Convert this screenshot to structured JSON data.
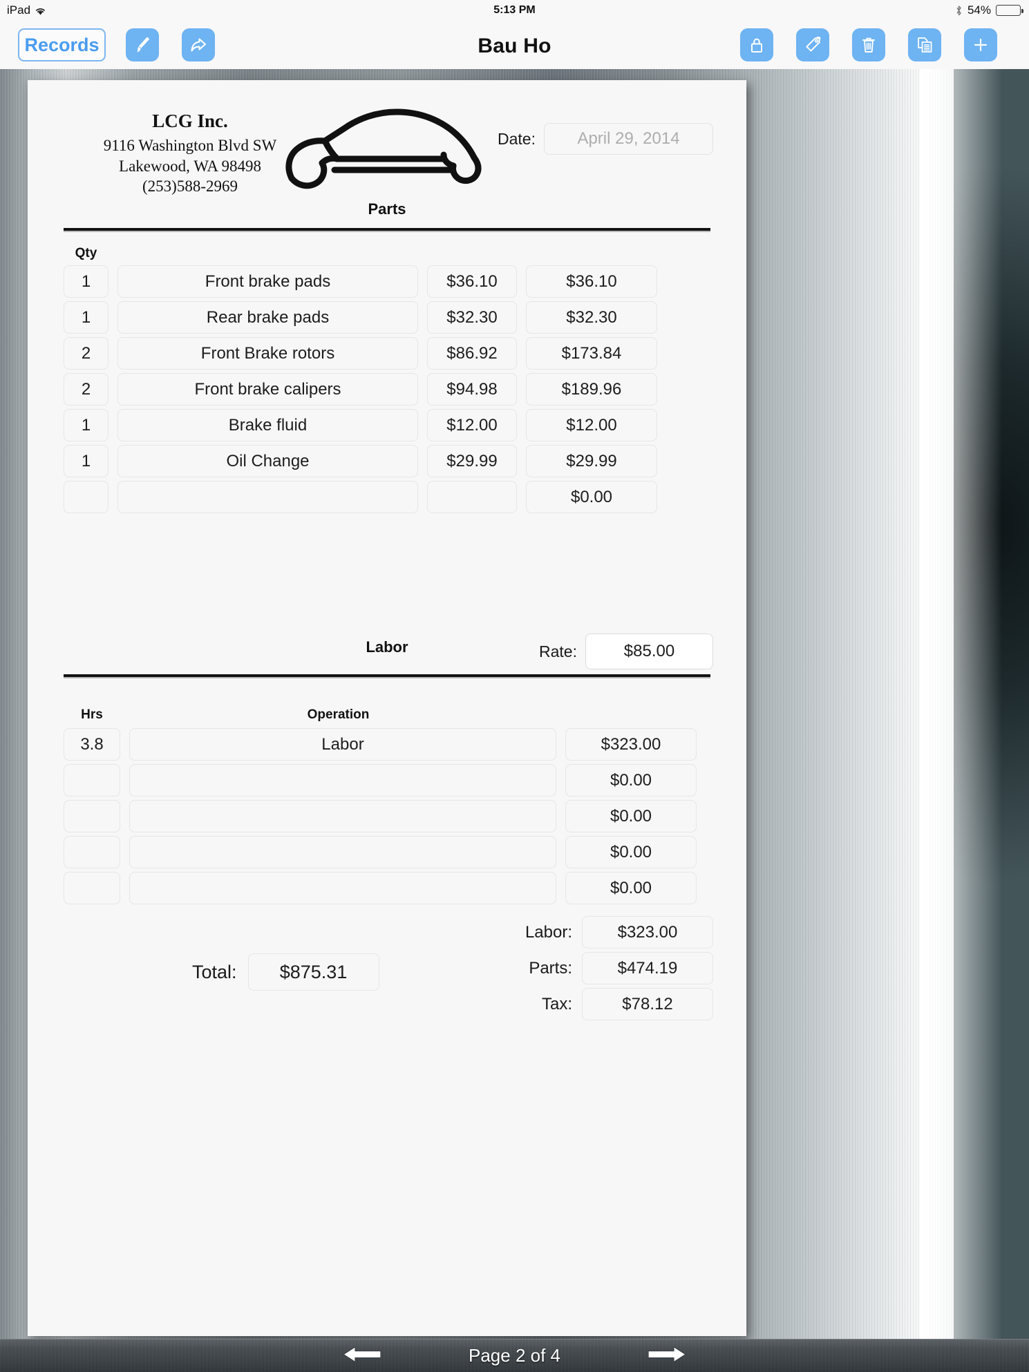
{
  "status_bar": {
    "device": "iPad",
    "wifi_icon": "wifi-icon",
    "time": "5:13 PM",
    "bluetooth_icon": "bluetooth-icon",
    "battery_percent": "54%",
    "battery_level": 54
  },
  "toolbar": {
    "back_label": "Records",
    "title": "Bau Ho",
    "left_icons": [
      {
        "name": "brush-icon"
      },
      {
        "name": "share-icon"
      }
    ],
    "right_icons": [
      {
        "name": "lock-icon"
      },
      {
        "name": "tag-icon"
      },
      {
        "name": "trash-icon"
      },
      {
        "name": "duplicate-icon"
      },
      {
        "name": "plus-icon"
      }
    ],
    "accent_color": "#6eb3f2"
  },
  "document": {
    "company": {
      "name": "LCG Inc.",
      "address_line1": "9116 Washington Blvd SW",
      "address_line2": "Lakewood, WA  98498",
      "phone": "(253)588-2969"
    },
    "logo_icon": "car-wrench-logo-icon",
    "date": {
      "label": "Date:",
      "value": "April 29, 2014"
    },
    "parts": {
      "section_title": "Parts",
      "qty_header": "Qty",
      "rows": [
        {
          "qty": "1",
          "description": "Front brake pads",
          "price": "$36.10",
          "total": "$36.10"
        },
        {
          "qty": "1",
          "description": "Rear brake pads",
          "price": "$32.30",
          "total": "$32.30"
        },
        {
          "qty": "2",
          "description": "Front Brake rotors",
          "price": "$86.92",
          "total": "$173.84"
        },
        {
          "qty": "2",
          "description": "Front brake calipers",
          "price": "$94.98",
          "total": "$189.96"
        },
        {
          "qty": "1",
          "description": "Brake fluid",
          "price": "$12.00",
          "total": "$12.00"
        },
        {
          "qty": "1",
          "description": "Oil Change",
          "price": "$29.99",
          "total": "$29.99"
        },
        {
          "qty": "",
          "description": "",
          "price": "",
          "total": "$0.00"
        }
      ]
    },
    "labor": {
      "section_title": "Labor",
      "rate_label": "Rate:",
      "rate_value": "$85.00",
      "hrs_header": "Hrs",
      "operation_header": "Operation",
      "rows": [
        {
          "hrs": "3.8",
          "operation": "Labor",
          "amount": "$323.00"
        },
        {
          "hrs": "",
          "operation": "",
          "amount": "$0.00"
        },
        {
          "hrs": "",
          "operation": "",
          "amount": "$0.00"
        },
        {
          "hrs": "",
          "operation": "",
          "amount": "$0.00"
        },
        {
          "hrs": "",
          "operation": "",
          "amount": "$0.00"
        }
      ]
    },
    "totals": {
      "labor_label": "Labor:",
      "labor_value": "$323.00",
      "parts_label": "Parts:",
      "parts_value": "$474.19",
      "tax_label": "Tax:",
      "tax_value": "$78.12",
      "total_label": "Total:",
      "total_value": "$875.31"
    }
  },
  "page_nav": {
    "prev_icon": "arrow-left-icon",
    "label": "Page 2 of 4",
    "next_icon": "arrow-right-icon"
  }
}
